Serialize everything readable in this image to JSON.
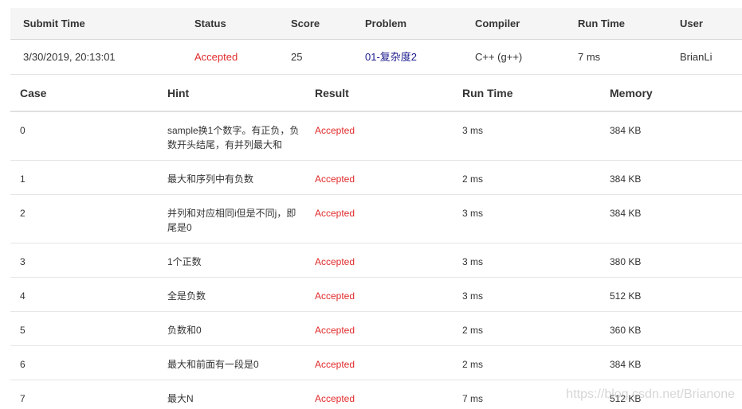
{
  "summary": {
    "headers": [
      "Submit Time",
      "Status",
      "Score",
      "Problem",
      "Compiler",
      "Run Time",
      "User"
    ],
    "row": {
      "submit_time": "3/30/2019, 20:13:01",
      "status": "Accepted",
      "score": "25",
      "problem": "01-复杂度2",
      "compiler": "C++ (g++)",
      "run_time": "7 ms",
      "user": "BrianLi"
    }
  },
  "cases": {
    "headers": [
      "Case",
      "Hint",
      "Result",
      "Run Time",
      "Memory"
    ],
    "rows": [
      {
        "case": "0",
        "hint": "sample换1个数字。有正负，负数开头结尾，有并列最大和",
        "result": "Accepted",
        "run_time": "3 ms",
        "memory": "384 KB"
      },
      {
        "case": "1",
        "hint": "最大和序列中有负数",
        "result": "Accepted",
        "run_time": "2 ms",
        "memory": "384 KB"
      },
      {
        "case": "2",
        "hint": "并列和对应相同i但是不同j，即尾是0",
        "result": "Accepted",
        "run_time": "3 ms",
        "memory": "384 KB"
      },
      {
        "case": "3",
        "hint": "1个正数",
        "result": "Accepted",
        "run_time": "3 ms",
        "memory": "380 KB"
      },
      {
        "case": "4",
        "hint": "全是负数",
        "result": "Accepted",
        "run_time": "3 ms",
        "memory": "512 KB"
      },
      {
        "case": "5",
        "hint": "负数和0",
        "result": "Accepted",
        "run_time": "2 ms",
        "memory": "360 KB"
      },
      {
        "case": "6",
        "hint": "最大和前面有一段是0",
        "result": "Accepted",
        "run_time": "2 ms",
        "memory": "384 KB"
      },
      {
        "case": "7",
        "hint": "最大N",
        "result": "Accepted",
        "run_time": "7 ms",
        "memory": "512 KB"
      }
    ]
  },
  "watermark": "https://blog.csdn.net/Brianone",
  "colors": {
    "accepted": "#e12b2b",
    "problem_link": "#1a1a8c",
    "header_bg": "#f5f5f5"
  }
}
